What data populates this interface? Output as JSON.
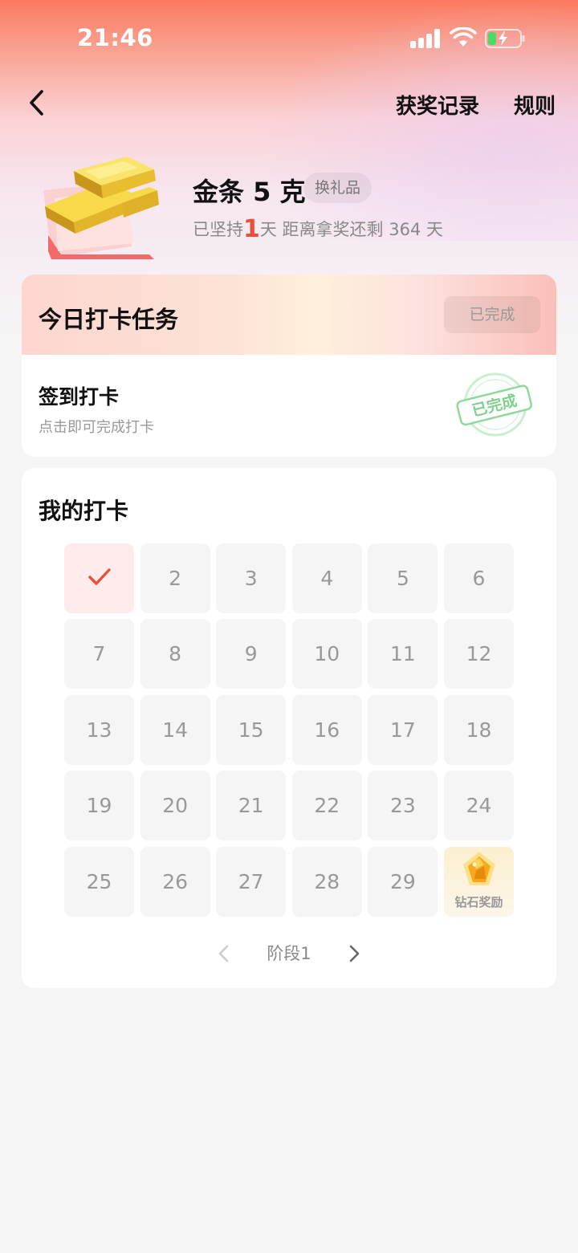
{
  "status_bar": {
    "time": "21:46"
  },
  "nav": {
    "records": "获奖记录",
    "rules": "规则"
  },
  "prize": {
    "title": "金条 5 克",
    "badge": "换礼品",
    "sub_prefix": "已坚持",
    "days_kept": "1",
    "sub_suffix": "天 距离拿奖还剩 364 天"
  },
  "task_card": {
    "title": "今日打卡任务",
    "status_button": "已完成",
    "task_name": "签到打卡",
    "task_desc": "点击即可完成打卡",
    "stamp_text": "已完成"
  },
  "my_card": {
    "title": "我的打卡",
    "cells": [
      "",
      "2",
      "3",
      "4",
      "5",
      "6",
      "7",
      "8",
      "9",
      "10",
      "11",
      "12",
      "13",
      "14",
      "15",
      "16",
      "17",
      "18",
      "19",
      "20",
      "21",
      "22",
      "23",
      "24",
      "25",
      "26",
      "27",
      "28",
      "29",
      ""
    ],
    "completed_day": 1,
    "reward_label": "钻石奖励",
    "stage_label": "阶段1"
  },
  "colors": {
    "accent_red": "#ec4f37",
    "stamp_green": "#8fd99a",
    "done_cell": "#fdeceb"
  },
  "icons": [
    "back-chevron-icon",
    "check-icon",
    "diamond-icon",
    "chevron-left-icon",
    "chevron-right-icon",
    "signal-icon",
    "wifi-icon",
    "battery-icon"
  ]
}
